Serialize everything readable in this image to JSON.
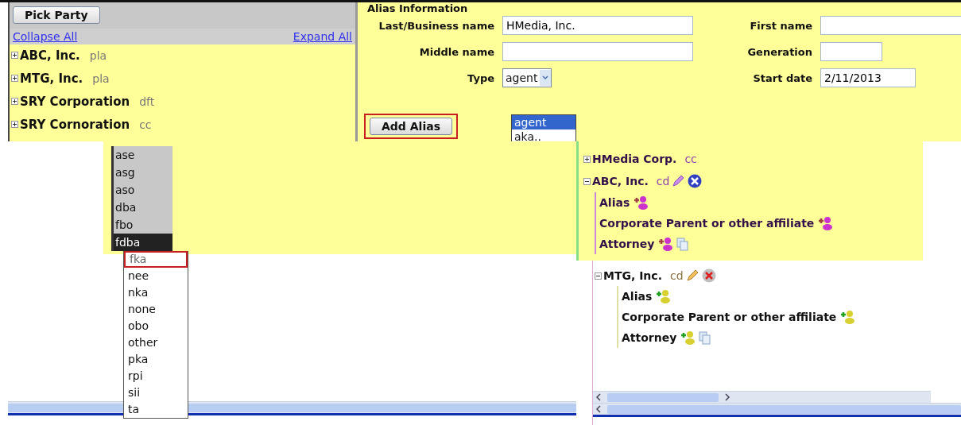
{
  "party_panel": {
    "pick_button": "Pick Party",
    "collapse_link": "Collapse All",
    "expand_link": "Expand All",
    "parties": [
      {
        "name": "ABC, Inc.",
        "role": "pla",
        "expanded": false
      },
      {
        "name": "MTG, Inc.",
        "role": "pla",
        "expanded": false
      },
      {
        "name": "SRY Corporation",
        "role": "dft",
        "expanded": false
      },
      {
        "name": "SRY Cornoration",
        "role": "cc",
        "expanded": false
      }
    ]
  },
  "alias_form": {
    "title": "Alias Information",
    "fields": [
      {
        "label": "Last/Business name",
        "value": "HMedia, Inc.",
        "kind": "text"
      },
      {
        "label": "First name",
        "kind": "text"
      },
      {
        "label": "Middle name",
        "kind": "text"
      },
      {
        "label": "Generation",
        "kind": "short"
      },
      {
        "label": "Type",
        "value": "agent",
        "kind": "select"
      },
      {
        "label": "Start date",
        "value": "2/11/2013",
        "kind": "date"
      }
    ],
    "add_button": "Add Alias",
    "type_options": [
      {
        "label": "agent",
        "selected": true
      },
      {
        "label": "aka..",
        "selected": false
      }
    ]
  },
  "type_list_upper": [
    {
      "label": "ase",
      "selected": false
    },
    {
      "label": "asg",
      "selected": false
    },
    {
      "label": "aso",
      "selected": false
    },
    {
      "label": "dba",
      "selected": false
    },
    {
      "label": "fbo",
      "selected": false
    },
    {
      "label": "fdba",
      "selected": true
    }
  ],
  "type_list_lower": [
    {
      "label": "fka",
      "focused": true
    },
    {
      "label": "nee",
      "focused": false
    },
    {
      "label": "nka",
      "focused": false
    },
    {
      "label": "none",
      "focused": false
    },
    {
      "label": "obo",
      "focused": false
    },
    {
      "label": "other",
      "focused": false
    },
    {
      "label": "pka",
      "focused": false
    },
    {
      "label": "rpi",
      "focused": false
    },
    {
      "label": "sii",
      "focused": false
    },
    {
      "label": "ta",
      "focused": false
    }
  ],
  "tree_tinted": [
    {
      "name": "HMedia Corp.",
      "role": "cc",
      "expanded": false
    },
    {
      "name": "ABC, Inc.",
      "role": "cd",
      "expanded": true,
      "children": [
        {
          "label": "Alias",
          "has_copy": false
        },
        {
          "label": "Corporate Parent or other affiliate",
          "has_copy": false
        },
        {
          "label": "Attorney",
          "has_copy": true
        }
      ]
    }
  ],
  "tree": [
    {
      "name": "MTG, Inc.",
      "role": "cd",
      "expanded": true,
      "children": [
        {
          "label": "Alias",
          "has_copy": false
        },
        {
          "label": "Corporate Parent or other affiliate",
          "has_copy": false
        },
        {
          "label": "Attorney",
          "has_copy": true
        }
      ]
    }
  ]
}
